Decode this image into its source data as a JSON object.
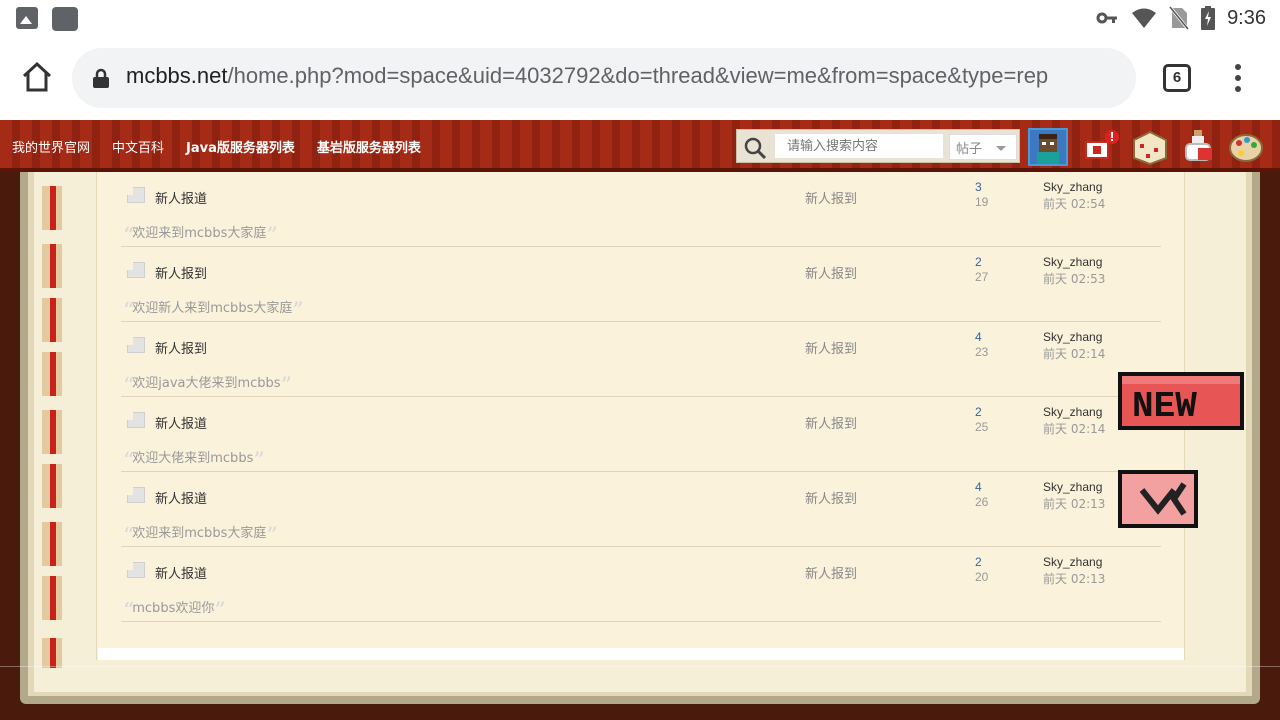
{
  "statusbar": {
    "time": "9:36"
  },
  "browser": {
    "url_host": "mcbbs.net",
    "url_path": "/home.php?mod=space&uid=4032792&do=thread&view=me&from=space&type=rep",
    "tab_count": "6"
  },
  "nav": {
    "links": [
      "我的世界官网",
      "中文百科",
      "Java版服务器列表",
      "基岩版服务器列表"
    ],
    "search_placeholder": "请输入搜索内容",
    "search_type": "帖子"
  },
  "threads": [
    {
      "title": "新人报道",
      "forum": "新人报到",
      "replies": "3",
      "views": "19",
      "last_by": "Sky_zhang",
      "last_time": "前天 02:54",
      "quote": "欢迎来到mcbbs大家庭"
    },
    {
      "title": "新人报到",
      "forum": "新人报到",
      "replies": "2",
      "views": "27",
      "last_by": "Sky_zhang",
      "last_time": "前天 02:53",
      "quote": "欢迎新人来到mcbbs大家庭"
    },
    {
      "title": "新人报到",
      "forum": "新人报到",
      "replies": "4",
      "views": "23",
      "last_by": "Sky_zhang",
      "last_time": "前天 02:14",
      "quote": "欢迎java大佬来到mcbbs"
    },
    {
      "title": "新人报道",
      "forum": "新人报到",
      "replies": "2",
      "views": "25",
      "last_by": "Sky_zhang",
      "last_time": "前天 02:14",
      "quote": "欢迎大佬来到mcbbs"
    },
    {
      "title": "新人报道",
      "forum": "新人报到",
      "replies": "4",
      "views": "26",
      "last_by": "Sky_zhang",
      "last_time": "前天 02:13",
      "quote": "欢迎来到mcbbs大家庭"
    },
    {
      "title": "新人报道",
      "forum": "新人报到",
      "replies": "2",
      "views": "20",
      "last_by": "Sky_zhang",
      "last_time": "前天 02:13",
      "quote": "mcbbs欢迎你"
    }
  ],
  "side_tabs": {
    "new_label": "NEW"
  },
  "icons": [
    "image-icon",
    "app-icon",
    "key-icon",
    "wifi-icon",
    "no-sim-icon",
    "battery-icon",
    "home-icon",
    "lock-icon",
    "tabs-icon",
    "menu-icon",
    "search-icon",
    "avatar",
    "notification-icon",
    "cake-icon",
    "potion-icon",
    "palette-icon",
    "thread-icon"
  ],
  "colors": {
    "nav_red": "#a52b16",
    "page_bg": "#fbf2dc",
    "reply_blue": "#336699"
  }
}
